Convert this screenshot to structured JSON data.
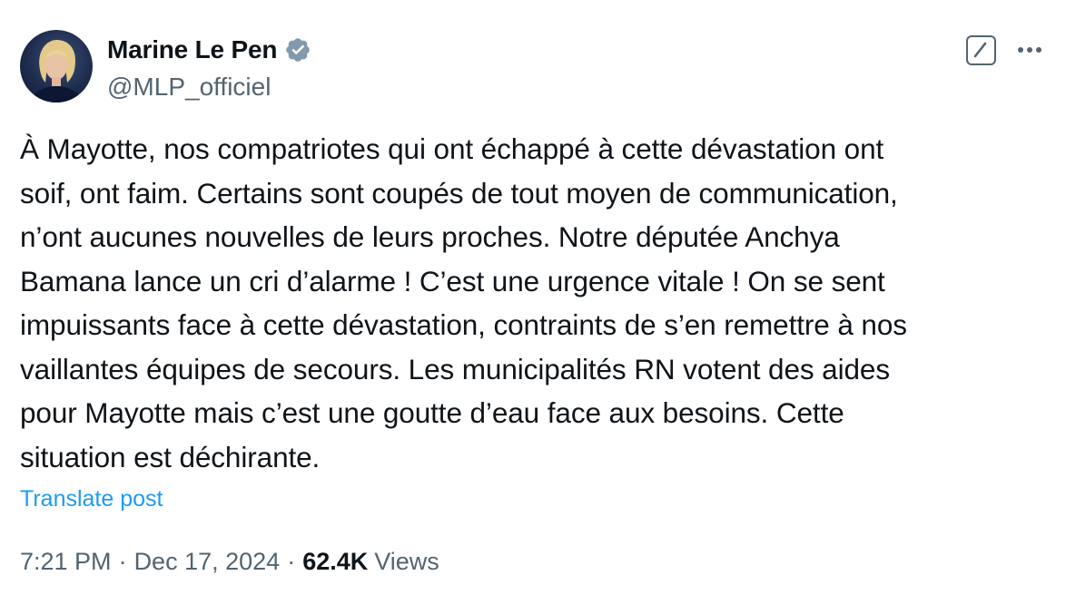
{
  "author": {
    "display_name": "Marine Le Pen",
    "handle": "@MLP_officiel",
    "verified_icon": "verified-badge-icon",
    "badge_color": "#829aab"
  },
  "actions": {
    "grok_icon": "grok-icon",
    "more_icon": "more-options-icon"
  },
  "post": {
    "lines": [
      "À Mayotte, nos compatriotes qui ont échappé à cette dévastation ont",
      "soif, ont faim. Certains sont coupés de tout moyen de communication,",
      "n’ont aucunes nouvelles de leurs proches. Notre députée Anchya",
      "Bamana lance un cri d’alarme ! C’est une urgence vitale ! On se sent",
      "impuissants face à cette dévastation, contraints de s’en remettre à nos",
      "vaillantes équipes de secours. Les municipalités RN votent des aides",
      "pour Mayotte mais c’est une goutte d’eau face aux besoins. Cette",
      "situation est déchirante."
    ],
    "translate_label": "Translate post"
  },
  "meta": {
    "time": "7:21 PM",
    "separator": "·",
    "date": "Dec 17, 2024",
    "views_count": "62.4K",
    "views_label": "Views"
  },
  "colors": {
    "text_primary": "#0f1419",
    "text_secondary": "#536471",
    "link": "#1d9bf0"
  }
}
